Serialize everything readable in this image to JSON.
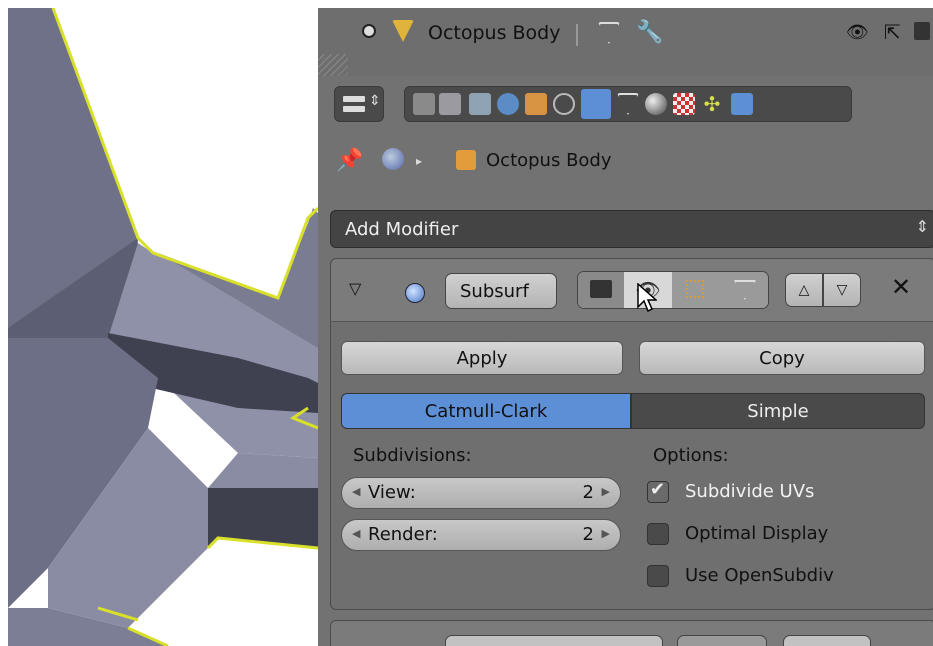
{
  "header": {
    "object_name": "Octopus Body"
  },
  "context": {
    "object_name": "Octopus Body"
  },
  "add_modifier": {
    "label": "Add Modifier"
  },
  "modifier": {
    "name": "Subsurf",
    "apply_label": "Apply",
    "copy_label": "Copy",
    "mode_catmull": "Catmull-Clark",
    "mode_simple": "Simple",
    "subdivisions_label": "Subdivisions:",
    "options_label": "Options:",
    "view_label": "View:",
    "view_value": "2",
    "render_label": "Render:",
    "render_value": "2",
    "subdivide_uvs": "Subdivide UVs",
    "optimal_display": "Optimal Display",
    "use_opensubdiv": "Use OpenSubdiv"
  },
  "colors": {
    "panel_bg": "#727272",
    "accent_blue": "#5d8fd6",
    "outline_yellow": "#d9e02a"
  }
}
